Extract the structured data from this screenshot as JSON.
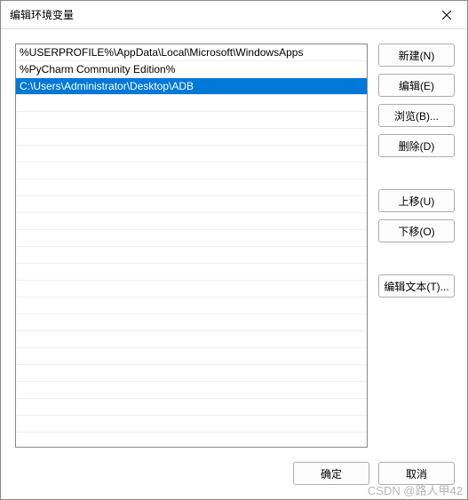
{
  "titlebar": {
    "title": "编辑环境变量"
  },
  "list": {
    "items": [
      {
        "text": "%USERPROFILE%\\AppData\\Local\\Microsoft\\WindowsApps",
        "selected": false
      },
      {
        "text": "%PyCharm Community Edition%",
        "selected": false
      },
      {
        "text": "C:\\Users\\Administrator\\Desktop\\ADB",
        "selected": true
      }
    ],
    "empty_rows": 20
  },
  "buttons": {
    "new": "新建(N)",
    "edit": "编辑(E)",
    "browse": "浏览(B)...",
    "delete": "删除(D)",
    "move_up": "上移(U)",
    "move_down": "下移(O)",
    "edit_text": "编辑文本(T)..."
  },
  "footer": {
    "ok": "确定",
    "cancel": "取消"
  },
  "watermark": "CSDN @路人甲42"
}
